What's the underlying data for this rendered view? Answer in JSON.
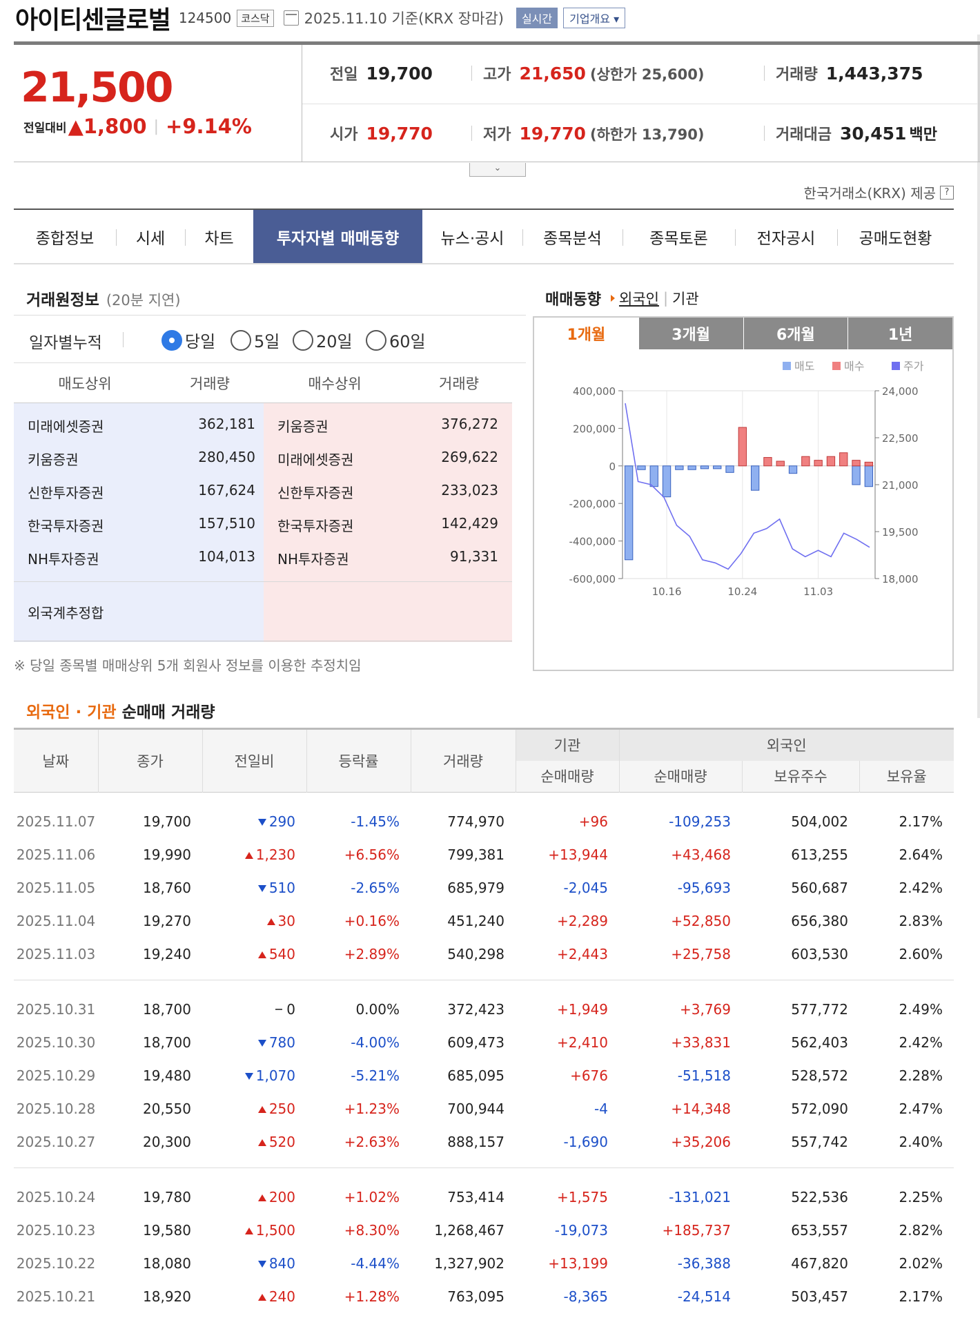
{
  "header": {
    "company": "아이티센글로벌",
    "code": "124500",
    "market": "코스닥",
    "date": "2025.11.10 기준(KRX 장마감)",
    "realtime": "실시간",
    "overview": "기업개요"
  },
  "price": {
    "current": "21,500",
    "change_label": "전일대비",
    "change": "1,800",
    "change_pct": "+9.14%",
    "prev_label": "전일",
    "prev": "19,700",
    "high_label": "고가",
    "high": "21,650",
    "upper_limit": "(상한가 25,600)",
    "volume_label": "거래량",
    "volume": "1,443,375",
    "open_label": "시가",
    "open": "19,770",
    "low_label": "저가",
    "low": "19,770",
    "lower_limit": "(하한가 13,790)",
    "value_label": "거래대금",
    "value": "30,451",
    "value_unit": "백만"
  },
  "credit": "한국거래소(KRX) 제공",
  "tabs": [
    "종합정보",
    "시세",
    "차트",
    "투자자별 매매동향",
    "뉴스·공시",
    "종목분석",
    "종목토론",
    "전자공시",
    "공매도현황"
  ],
  "broker": {
    "title": "거래원정보",
    "delay": "(20분 지연)",
    "period_label": "일자별누적",
    "periods": [
      "당일",
      "5일",
      "20일",
      "60일"
    ],
    "headers": [
      "매도상위",
      "거래량",
      "매수상위",
      "거래량"
    ],
    "rows": [
      {
        "sell": "미래에셋증권",
        "sell_vol": "362,181",
        "buy": "키움증권",
        "buy_vol": "376,272"
      },
      {
        "sell": "키움증권",
        "sell_vol": "280,450",
        "buy": "미래에셋증권",
        "buy_vol": "269,622"
      },
      {
        "sell": "신한투자증권",
        "sell_vol": "167,624",
        "buy": "신한투자증권",
        "buy_vol": "233,023"
      },
      {
        "sell": "한국투자증권",
        "sell_vol": "157,510",
        "buy": "한국투자증권",
        "buy_vol": "142,429"
      },
      {
        "sell": "NH투자증권",
        "sell_vol": "104,013",
        "buy": "NH투자증권",
        "buy_vol": "91,331"
      }
    ],
    "foreign_est": "외국계추정합",
    "note": "※ 당일 종목별 매매상위 5개 회원사 정보를 이용한 추정치임"
  },
  "trend": {
    "title": "매매동향",
    "link_foreign": "외국인",
    "link_inst": "기관",
    "period_tabs": [
      "1개월",
      "3개월",
      "6개월",
      "1년"
    ]
  },
  "colors": {
    "sell": "#8fb0f0",
    "buy": "#f08080",
    "price_line": "#6f6ff0",
    "up": "#d6241c",
    "down": "#1c4fc8"
  },
  "chart_data": {
    "type": "bar",
    "legend": [
      "매도",
      "매수",
      "주가"
    ],
    "y_left_ticks": [
      "400,000",
      "200,000",
      "0",
      "-200,000",
      "-400,000",
      "-600,000"
    ],
    "y_left_range": [
      -600000,
      400000
    ],
    "y_right_ticks": [
      "24,000",
      "22,500",
      "21,000",
      "19,500",
      "18,000"
    ],
    "y_right_range": [
      18000,
      24000
    ],
    "x_tick_labels": [
      "10.16",
      "10.24",
      "11.03"
    ],
    "x_tick_index": [
      3,
      9,
      15
    ],
    "series": [
      {
        "name": "매도",
        "values": [
          -500000,
          -20000,
          -110000,
          -165000,
          -20000,
          -20000,
          -15000,
          -15000,
          -35000,
          0,
          -130000,
          0,
          0,
          -40000,
          0,
          0,
          0,
          0,
          -100000,
          -110000
        ]
      },
      {
        "name": "매수",
        "values": [
          0,
          0,
          0,
          0,
          0,
          0,
          0,
          0,
          0,
          205000,
          0,
          45000,
          25000,
          0,
          50000,
          30000,
          50000,
          70000,
          30000,
          20000
        ]
      },
      {
        "name": "주가",
        "values": [
          23600,
          21100,
          21000,
          20600,
          19700,
          19350,
          18600,
          18500,
          18300,
          18800,
          19450,
          19600,
          19900,
          18950,
          18700,
          18900,
          18700,
          19450,
          19250,
          19000
        ]
      }
    ]
  },
  "net_table": {
    "title_hl": "외국인 · 기관",
    "title_rest": " 순매매 거래량",
    "headers": {
      "date": "날짜",
      "close": "종가",
      "change": "전일비",
      "rate": "등락률",
      "volume": "거래량",
      "inst": "기관",
      "foreign": "외국인",
      "inst_net": "순매매량",
      "foreign_net": "순매매량",
      "holding": "보유주수",
      "ratio": "보유율"
    },
    "groups": [
      [
        {
          "date": "2025.11.07",
          "close": "19,700",
          "dir": "down",
          "change": "290",
          "rate": "-1.45%",
          "volume": "774,970",
          "inst": "+96",
          "foreign": "-109,253",
          "holding": "504,002",
          "ratio": "2.17%"
        },
        {
          "date": "2025.11.06",
          "close": "19,990",
          "dir": "up",
          "change": "1,230",
          "rate": "+6.56%",
          "volume": "799,381",
          "inst": "+13,944",
          "foreign": "+43,468",
          "holding": "613,255",
          "ratio": "2.64%"
        },
        {
          "date": "2025.11.05",
          "close": "18,760",
          "dir": "down",
          "change": "510",
          "rate": "-2.65%",
          "volume": "685,979",
          "inst": "-2,045",
          "foreign": "-95,693",
          "holding": "560,687",
          "ratio": "2.42%"
        },
        {
          "date": "2025.11.04",
          "close": "19,270",
          "dir": "up",
          "change": "30",
          "rate": "+0.16%",
          "volume": "451,240",
          "inst": "+2,289",
          "foreign": "+52,850",
          "holding": "656,380",
          "ratio": "2.83%"
        },
        {
          "date": "2025.11.03",
          "close": "19,240",
          "dir": "up",
          "change": "540",
          "rate": "+2.89%",
          "volume": "540,298",
          "inst": "+2,443",
          "foreign": "+25,758",
          "holding": "603,530",
          "ratio": "2.60%"
        }
      ],
      [
        {
          "date": "2025.10.31",
          "close": "18,700",
          "dir": "flat",
          "change": "0",
          "rate": "0.00%",
          "volume": "372,423",
          "inst": "+1,949",
          "foreign": "+3,769",
          "holding": "577,772",
          "ratio": "2.49%"
        },
        {
          "date": "2025.10.30",
          "close": "18,700",
          "dir": "down",
          "change": "780",
          "rate": "-4.00%",
          "volume": "609,473",
          "inst": "+2,410",
          "foreign": "+33,831",
          "holding": "562,403",
          "ratio": "2.42%"
        },
        {
          "date": "2025.10.29",
          "close": "19,480",
          "dir": "down",
          "change": "1,070",
          "rate": "-5.21%",
          "volume": "685,095",
          "inst": "+676",
          "foreign": "-51,518",
          "holding": "528,572",
          "ratio": "2.28%"
        },
        {
          "date": "2025.10.28",
          "close": "20,550",
          "dir": "up",
          "change": "250",
          "rate": "+1.23%",
          "volume": "700,944",
          "inst": "-4",
          "foreign": "+14,348",
          "holding": "572,090",
          "ratio": "2.47%"
        },
        {
          "date": "2025.10.27",
          "close": "20,300",
          "dir": "up",
          "change": "520",
          "rate": "+2.63%",
          "volume": "888,157",
          "inst": "-1,690",
          "foreign": "+35,206",
          "holding": "557,742",
          "ratio": "2.40%"
        }
      ],
      [
        {
          "date": "2025.10.24",
          "close": "19,780",
          "dir": "up",
          "change": "200",
          "rate": "+1.02%",
          "volume": "753,414",
          "inst": "+1,575",
          "foreign": "-131,021",
          "holding": "522,536",
          "ratio": "2.25%"
        },
        {
          "date": "2025.10.23",
          "close": "19,580",
          "dir": "up",
          "change": "1,500",
          "rate": "+8.30%",
          "volume": "1,268,467",
          "inst": "-19,073",
          "foreign": "+185,737",
          "holding": "653,557",
          "ratio": "2.82%"
        },
        {
          "date": "2025.10.22",
          "close": "18,080",
          "dir": "down",
          "change": "840",
          "rate": "-4.44%",
          "volume": "1,327,902",
          "inst": "+13,199",
          "foreign": "-36,388",
          "holding": "467,820",
          "ratio": "2.02%"
        },
        {
          "date": "2025.10.21",
          "close": "18,920",
          "dir": "up",
          "change": "240",
          "rate": "+1.28%",
          "volume": "763,095",
          "inst": "-8,365",
          "foreign": "-24,514",
          "holding": "503,457",
          "ratio": "2.17%"
        }
      ]
    ]
  }
}
